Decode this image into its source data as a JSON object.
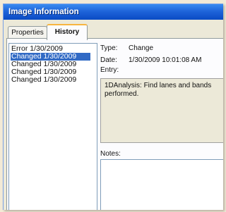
{
  "window": {
    "title": "Image Information"
  },
  "tabs": [
    {
      "label": "Properties",
      "active": false
    },
    {
      "label": "History",
      "active": true
    }
  ],
  "history_list": {
    "items": [
      "Error 1/30/2009",
      "Changed 1/30/2009",
      "Changed 1/30/2009",
      "Changed 1/30/2009",
      "Changed 1/30/2009"
    ],
    "selected_index": 1
  },
  "details": {
    "type_label": "Type:",
    "type_value": "Change",
    "date_label": "Date:",
    "date_value": "1/30/2009 10:01:08 AM",
    "entry_label": "Entry:",
    "entry_text": "1DAnalysis: Find lanes and bands performed.",
    "notes_label": "Notes:",
    "notes_text": ""
  },
  "colors": {
    "titlebar": "#1f64da",
    "selection": "#316ac5",
    "active_tab_accent": "#f7b53f"
  }
}
